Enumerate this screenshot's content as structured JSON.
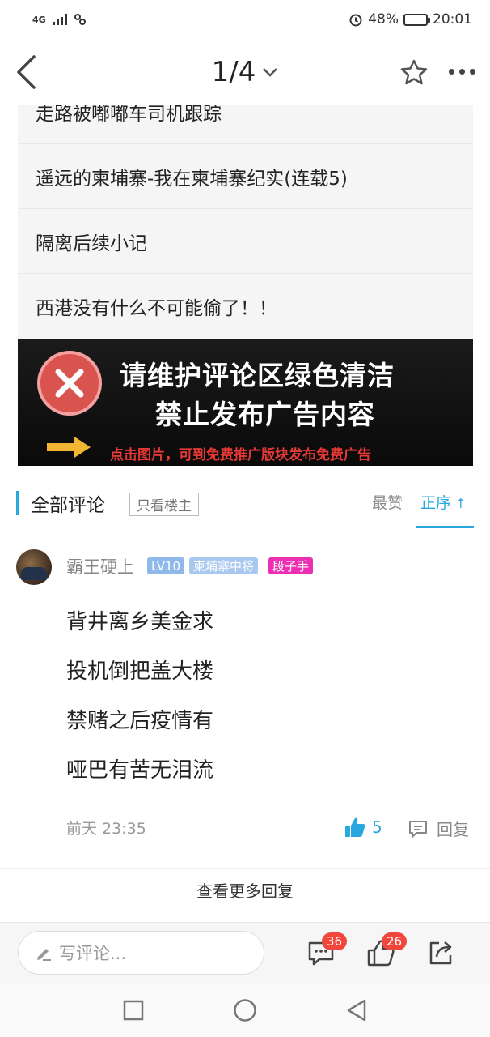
{
  "status_bar": {
    "network": "4G",
    "battery_percent": "48%",
    "battery_level": 0.48,
    "time": "20:01"
  },
  "nav": {
    "page_indicator": "1/4",
    "icons": [
      "back-arrow-icon",
      "star-icon",
      "more-icon"
    ]
  },
  "related": {
    "items": [
      "走路被嘟嘟车司机跟踪",
      "遥远的柬埔寨-我在柬埔寨纪实(连载5)",
      "隔离后续小记",
      "西港没有什么不可能偷了！！"
    ]
  },
  "ad": {
    "line1": "请维护评论区绿色清洁",
    "line2": "禁止发布广告内容",
    "line3": "点击图片，可到免费推广版块发布免费广告"
  },
  "comments_header": {
    "title": "全部评论",
    "filter": "只看楼主",
    "sort_hot": "最赞",
    "sort_order": "正序",
    "accent_color": "#29a8e0"
  },
  "comment": {
    "username": "霸王硬上",
    "level": "LV10",
    "rank": "柬埔寨中将",
    "tag": "段子手",
    "lines": [
      "背井离乡美金求",
      "投机倒把盖大楼",
      "禁赌之后疫情有",
      "哑巴有苦无泪流"
    ],
    "time": "前天 23:35",
    "likes": "5",
    "reply_label": "回复"
  },
  "more_replies": "查看更多回复",
  "bottom_bar": {
    "placeholder": "写评论...",
    "comment_count": "36",
    "like_count": "26"
  }
}
